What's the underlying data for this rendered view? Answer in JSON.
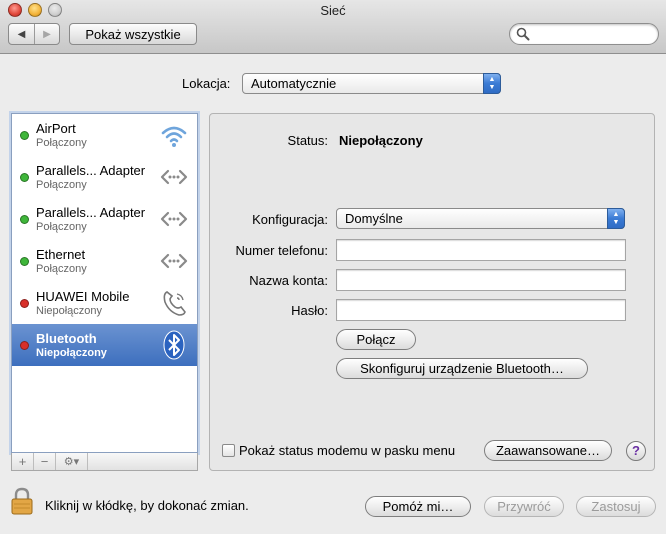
{
  "window": {
    "title": "Sieć"
  },
  "toolbar": {
    "back_glyph": "◀",
    "forward_glyph": "▶",
    "show_all_label": "Pokaż wszystkie",
    "search": {
      "placeholder": "",
      "value": ""
    }
  },
  "location": {
    "label": "Lokacja:",
    "value": "Automatycznie"
  },
  "services": [
    {
      "name": "AirPort",
      "status": "Połączony",
      "dot_color": "#3fb63a",
      "icon": "wifi-icon"
    },
    {
      "name": "Parallels... Adapter",
      "status": "Połączony",
      "dot_color": "#3fb63a",
      "icon": "ethernet-icon"
    },
    {
      "name": "Parallels... Adapter",
      "status": "Połączony",
      "dot_color": "#3fb63a",
      "icon": "ethernet-icon"
    },
    {
      "name": "Ethernet",
      "status": "Połączony",
      "dot_color": "#3fb63a",
      "icon": "ethernet-icon"
    },
    {
      "name": "HUAWEI Mobile",
      "status": "Niepołączony",
      "dot_color": "#d8302a",
      "icon": "phone-icon"
    },
    {
      "name": "Bluetooth",
      "status": "Niepołączony",
      "dot_color": "#d8302a",
      "icon": "bluetooth-icon",
      "selected": true
    }
  ],
  "list_toolbar": {
    "add": "+",
    "remove": "−",
    "gear": "⚙▾"
  },
  "detail": {
    "status_label": "Status:",
    "status_value": "Niepołączony",
    "configuration_label": "Konfiguracja:",
    "configuration_value": "Domyślne",
    "phone_label": "Numer telefonu:",
    "phone_value": "",
    "account_label": "Nazwa konta:",
    "account_value": "",
    "password_label": "Hasło:",
    "password_value": "",
    "connect_button": "Połącz",
    "configure_button": "Skonfiguruj urządzenie Bluetooth…",
    "show_modem_status": "Pokaż status modemu w pasku menu",
    "advanced_button": "Zaawansowane…",
    "help_glyph": "?"
  },
  "footer": {
    "lock_text": "Kliknij w kłódkę, by dokonać zmian.",
    "assist_button": "Pomóż mi…",
    "revert_button": "Przywróć",
    "apply_button": "Zastosuj"
  },
  "colors": {
    "selection": "#3d6fbe",
    "connected": "#3fb63a",
    "disconnected": "#d8302a",
    "popup_arrow": "#3b7bd4"
  }
}
